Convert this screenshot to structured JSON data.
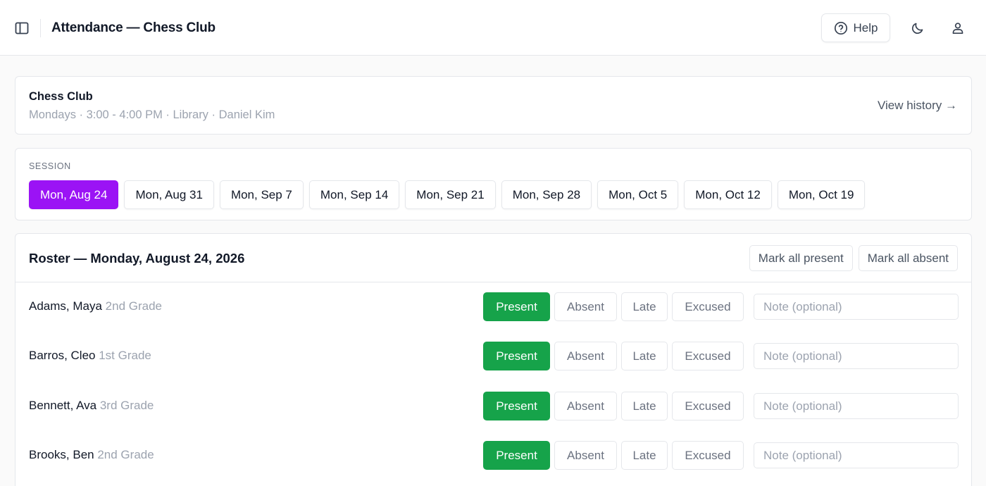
{
  "header": {
    "title": "Attendance — Chess Club",
    "help_label": "Help"
  },
  "club": {
    "name": "Chess Club",
    "meta": "Mondays · 3:00 - 4:00 PM · Library · Daniel Kim",
    "view_history_label": "View history →"
  },
  "session": {
    "label": "SESSION",
    "dates": [
      "Mon, Aug 24",
      "Mon, Aug 31",
      "Mon, Sep 7",
      "Mon, Sep 14",
      "Mon, Sep 21",
      "Mon, Sep 28",
      "Mon, Oct 5",
      "Mon, Oct 12",
      "Mon, Oct 19"
    ],
    "selected_index": 0
  },
  "roster": {
    "title": "Roster — Monday, August 24, 2026",
    "mark_all_present_label": "Mark all present",
    "mark_all_absent_label": "Mark all absent",
    "status_labels": [
      "Present",
      "Absent",
      "Late",
      "Excused"
    ],
    "note_placeholder": "Note (optional)",
    "students": [
      {
        "name": "Adams, Maya",
        "grade": "2nd Grade",
        "status": "Present"
      },
      {
        "name": "Barros, Cleo",
        "grade": "1st Grade",
        "status": "Present"
      },
      {
        "name": "Bennett, Ava",
        "grade": "3rd Grade",
        "status": "Present"
      },
      {
        "name": "Brooks, Ben",
        "grade": "2nd Grade",
        "status": "Present"
      }
    ]
  },
  "colors": {
    "accent": "#9b13f5",
    "present": "#16a34a"
  }
}
